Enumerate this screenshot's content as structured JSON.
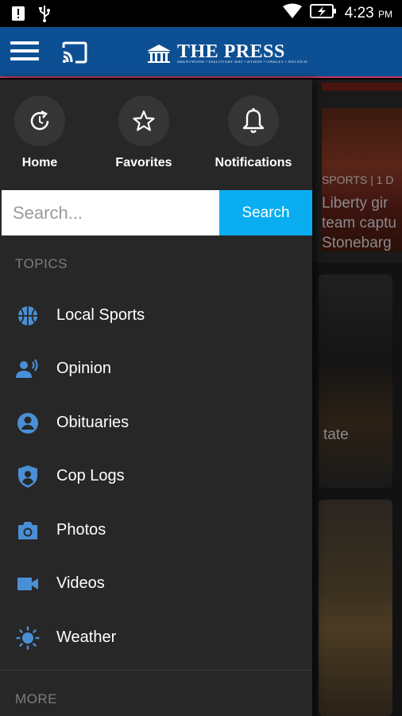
{
  "status_bar": {
    "time": "4:23",
    "ampm": "PM"
  },
  "app_bar": {
    "logo_text": "THE PRESS",
    "logo_subtitle": "BRENTWOOD • DISCOVERY BAY • BYRON • OAKLEY • ANTIOCH"
  },
  "quick_actions": [
    {
      "label": "Home",
      "icon": "refresh-icon"
    },
    {
      "label": "Favorites",
      "icon": "star-icon"
    },
    {
      "label": "Notifications",
      "icon": "bell-icon"
    }
  ],
  "search": {
    "placeholder": "Search...",
    "button_label": "Search"
  },
  "topics_header": "TOPICS",
  "topics": [
    {
      "label": "Local Sports",
      "icon": "basketball-icon"
    },
    {
      "label": "Opinion",
      "icon": "speaker-icon"
    },
    {
      "label": "Obituaries",
      "icon": "person-icon"
    },
    {
      "label": "Cop Logs",
      "icon": "shield-icon"
    },
    {
      "label": "Photos",
      "icon": "camera-icon"
    },
    {
      "label": "Videos",
      "icon": "video-icon"
    },
    {
      "label": "Weather",
      "icon": "sun-icon"
    }
  ],
  "more_header": "MORE",
  "background": {
    "line1": "SPORTS | 1 D",
    "line2": "Liberty gir",
    "line3": "team captu",
    "line4": "Stonebarg",
    "card2_text": "tate"
  },
  "colors": {
    "appbar": "#0d4f93",
    "drawer": "#272727",
    "search_button": "#0aaef0",
    "topic_icon": "#4a8fd6"
  }
}
